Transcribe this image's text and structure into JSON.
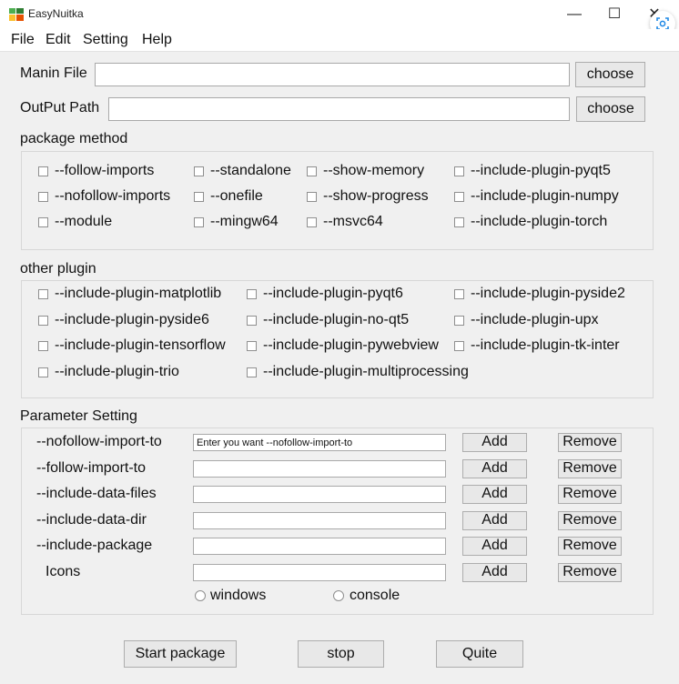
{
  "window": {
    "title": "EasyNuitka",
    "minimize_glyph": "—",
    "maximize_glyph": "☐",
    "close_glyph": "✕"
  },
  "menu": [
    "File",
    "Edit",
    "Setting",
    "Help"
  ],
  "main_file": {
    "label": "Manin File",
    "value": "",
    "button": "choose"
  },
  "output_path": {
    "label": "OutPut Path",
    "value": "",
    "button": "choose"
  },
  "package_method": {
    "label": "package method",
    "options": [
      "--follow-imports",
      "--standalone",
      "--show-memory",
      "--include-plugin-pyqt5",
      "--nofollow-imports",
      "--onefile",
      "--show-progress",
      "--include-plugin-numpy",
      "--module",
      "--mingw64",
      "--msvc64",
      "--include-plugin-torch"
    ]
  },
  "other_plugin": {
    "label": "other plugin",
    "options": [
      "--include-plugin-matplotlib",
      "--include-plugin-pyqt6",
      "--include-plugin-pyside2",
      "--include-plugin-pyside6",
      "--include-plugin-no-qt5",
      "--include-plugin-upx",
      "--include-plugin-tensorflow",
      "--include-plugin-pywebview",
      "--include-plugin-tk-inter",
      "--include-plugin-trio",
      "--include-plugin-multiprocessing"
    ]
  },
  "parameter_setting": {
    "label": "Parameter Setting",
    "add_label": "Add",
    "remove_label": "Remove",
    "rows": [
      {
        "label": "--nofollow-import-to",
        "value": "Enter you want --nofollow-import-to"
      },
      {
        "label": "--follow-import-to",
        "value": ""
      },
      {
        "label": "--include-data-files",
        "value": ""
      },
      {
        "label": "--include-data-dir",
        "value": ""
      },
      {
        "label": "--include-package",
        "value": ""
      },
      {
        "label": "Icons",
        "value": ""
      }
    ],
    "icon_mode": [
      "windows",
      "console"
    ]
  },
  "actions": {
    "start": "Start package",
    "stop": "stop",
    "quit": "Quite"
  },
  "colors": {
    "window_bg": "#f0f0f0",
    "button_bg": "#e8e8e8",
    "group_border": "#d7d7d7",
    "input_border": "#a9a9a9"
  }
}
